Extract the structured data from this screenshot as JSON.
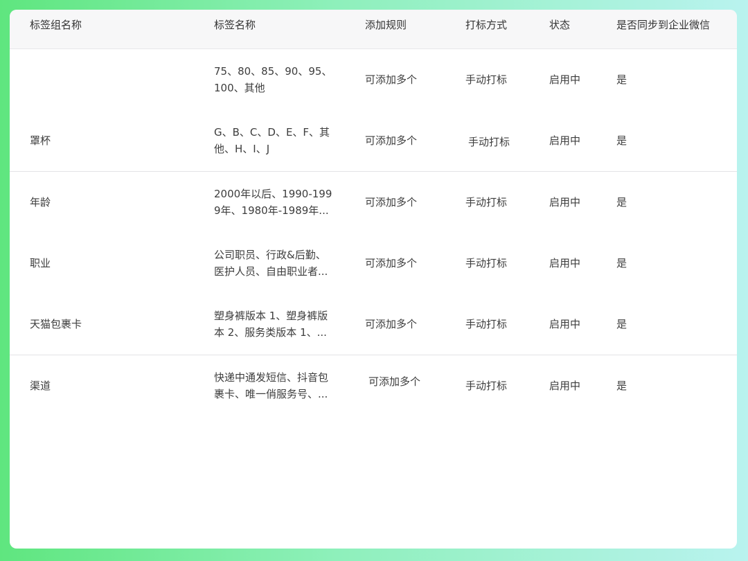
{
  "table": {
    "headers": {
      "group_name": "标签组名称",
      "tag_name": "标签名称",
      "add_rule": "添加规则",
      "tag_method": "打标方式",
      "status": "状态",
      "sync": "是否同步到企业微信"
    },
    "rows": [
      {
        "group_name": "",
        "tag_line1": "75、80、85、90、95、",
        "tag_line2": "100、其他",
        "add_rule": "可添加多个",
        "tag_method": "手动打标",
        "status": "启用中",
        "sync": "是"
      },
      {
        "group_name": "罩杯",
        "tag_line1": "G、B、C、D、E、F、其",
        "tag_line2": "他、H、I、J",
        "add_rule": "可添加多个",
        "tag_method": "手动打标",
        "status": "启用中",
        "sync": "是"
      },
      {
        "group_name": "年龄",
        "tag_line1": "2000年以后、1990-199",
        "tag_line2": "9年、1980年-1989年...",
        "add_rule": "可添加多个",
        "tag_method": "手动打标",
        "status": "启用中",
        "sync": "是"
      },
      {
        "group_name": "职业",
        "tag_line1": "公司职员、行政&后勤、",
        "tag_line2": "医护人员、自由职业者...",
        "add_rule": "可添加多个",
        "tag_method": "手动打标",
        "status": "启用中",
        "sync": "是"
      },
      {
        "group_name": "天猫包裹卡",
        "tag_line1": "塑身裤版本 1、塑身裤版",
        "tag_line2": "本 2、服务类版本 1、...",
        "add_rule": "可添加多个",
        "tag_method": "手动打标",
        "status": "启用中",
        "sync": "是"
      },
      {
        "group_name": "渠道",
        "tag_line1": "快递中通发短信、抖音包",
        "tag_line2": "裹卡、唯一俏服务号、...",
        "add_rule": "可添加多个",
        "tag_method": "手动打标",
        "status": "启用中",
        "sync": "是"
      }
    ]
  }
}
